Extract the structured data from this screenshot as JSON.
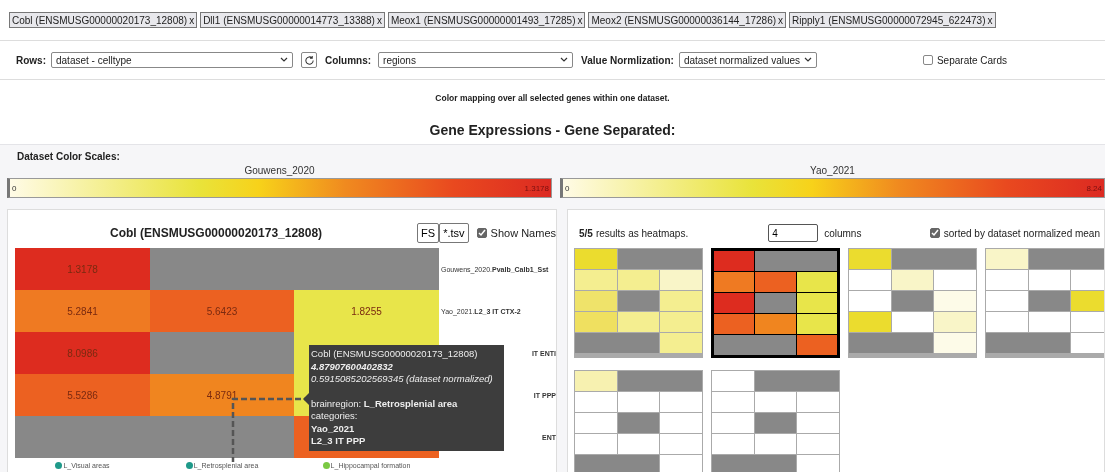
{
  "gene_tags": [
    {
      "label": "Cobl (ENSMUSG00000020173_12808)",
      "remove": "x"
    },
    {
      "label": "Dll1 (ENSMUSG00000014773_13388)",
      "remove": "x"
    },
    {
      "label": "Meox1 (ENSMUSG00000001493_17285)",
      "remove": "x"
    },
    {
      "label": "Meox2 (ENSMUSG00000036144_17286)",
      "remove": "x"
    },
    {
      "label": "Ripply1 (ENSMUSG00000072945_622473)",
      "remove": "x"
    }
  ],
  "controls": {
    "rows": {
      "label": "Rows:",
      "value": "dataset - celltype"
    },
    "columns": {
      "label": "Columns:",
      "value": "regions"
    },
    "normalization": {
      "label": "Value Normlization:",
      "value": "dataset normalized values"
    },
    "separate_cards": {
      "label": "Separate Cards",
      "checked": false
    }
  },
  "note": "Color mapping over all selected genes within one dataset.",
  "heading": "Gene Expressions - Gene Separated:",
  "color_scales": {
    "title": "Dataset Color Scales:",
    "scales": [
      {
        "name": "Gouwens_2020",
        "min": "0",
        "max": "1.3178"
      },
      {
        "name": "Yao_2021",
        "min": "0",
        "max": "8.24"
      }
    ]
  },
  "gene_panel": {
    "title": "Cobl (ENSMUSG00000020173_12808)",
    "buttons": [
      "FS",
      "*.tsv"
    ],
    "show_names": {
      "label": "Show Names",
      "checked": true
    },
    "rows": [
      {
        "prefix": "Gouwens_2020.",
        "name": "Pvalb_Calb1_Sst",
        "cells": [
          {
            "kind": "value",
            "color": "#dd2c1f",
            "value": "1.3178"
          },
          {
            "kind": "empty",
            "color": "#888888"
          },
          {
            "kind": "empty",
            "color": "#888888"
          }
        ]
      },
      {
        "prefix": "Yao_2021.",
        "name": "L2_3 IT CTX-2",
        "cells": [
          {
            "kind": "value",
            "color": "#ef7a22",
            "value": "5.2841"
          },
          {
            "kind": "value",
            "color": "#ec6121",
            "value": "5.6423"
          },
          {
            "kind": "value",
            "color": "#e8e54a",
            "value": "1.8255"
          }
        ]
      },
      {
        "name": "IT ENTl",
        "cells": [
          {
            "kind": "value",
            "color": "#dd2c1f",
            "value": "8.0986"
          },
          {
            "kind": "empty",
            "color": "#888888"
          },
          {
            "kind": "value",
            "color": "#e8e54a"
          }
        ]
      },
      {
        "name": "IT PPP",
        "cells": [
          {
            "kind": "value",
            "color": "#ec6121",
            "value": "5.5286"
          },
          {
            "kind": "value",
            "color": "#f0851f",
            "value": "4.8791"
          },
          {
            "kind": "value",
            "color": "#e8e54a"
          }
        ]
      },
      {
        "name": "ENT",
        "cells": [
          {
            "kind": "empty",
            "color": "#888888"
          },
          {
            "kind": "empty",
            "color": "#888888"
          },
          {
            "kind": "value",
            "color": "#ec6121"
          }
        ]
      }
    ],
    "axis_labels": [
      {
        "label": "L_Visual areas",
        "color": "#1f9a8a"
      },
      {
        "label": "L_Retrosplenial area",
        "color": "#1f9a8a"
      },
      {
        "label": "L_Hippocampal formation",
        "color": "#7ac943"
      }
    ],
    "tooltip": [
      {
        "kind": "plain",
        "text": "Cobl (ENSMUSG00000020173_12808)"
      },
      {
        "kind": "value",
        "text": "4.87907600402832"
      },
      {
        "kind": "normalized",
        "text": "0.5915085202569345 (dataset normalized)"
      },
      {
        "kind": "field",
        "text": "brainregion: **L_Retrosplenial area**"
      },
      {
        "kind": "plain",
        "text": "categories:"
      },
      {
        "kind": "strong",
        "text": "Yao_2021"
      },
      {
        "kind": "strong",
        "text": "L2_3 IT PPP"
      }
    ]
  },
  "results_panel": {
    "count": "5/5",
    "summary": "results as heatmaps.",
    "columns_value": "4",
    "columns_label": "columns",
    "sorted": {
      "label": "sorted by dataset normalized mean",
      "checked": true
    },
    "heatmaps": [
      {
        "selected": false,
        "cells": [
          {
            "kind": "value",
            "color": "#ebdc2e"
          },
          {
            "kind": "empty",
            "color": "#888888"
          },
          {
            "kind": "empty",
            "color": "#888888"
          },
          {
            "kind": "value",
            "color": "#f4ee90"
          },
          {
            "kind": "value",
            "color": "#f4ee90"
          },
          {
            "kind": "value",
            "color": "#f9f5c8"
          },
          {
            "kind": "value",
            "color": "#efe36a"
          },
          {
            "kind": "empty",
            "color": "#888888"
          },
          {
            "kind": "value",
            "color": "#f4ee90"
          },
          {
            "kind": "value",
            "color": "#efe060"
          },
          {
            "kind": "value",
            "color": "#f4ee90"
          },
          {
            "kind": "value",
            "color": "#f4ee90"
          },
          {
            "kind": "empty",
            "color": "#888888"
          },
          {
            "kind": "empty",
            "color": "#888888"
          },
          {
            "kind": "value",
            "color": "#f4ee90"
          }
        ]
      },
      {
        "selected": true,
        "cells": [
          {
            "kind": "value",
            "color": "#dd2c1f"
          },
          {
            "kind": "empty",
            "color": "#888888"
          },
          {
            "kind": "empty",
            "color": "#888888"
          },
          {
            "kind": "value",
            "color": "#ef7a22"
          },
          {
            "kind": "value",
            "color": "#ec6121"
          },
          {
            "kind": "value",
            "color": "#e8e54a"
          },
          {
            "kind": "value",
            "color": "#dd2c1f"
          },
          {
            "kind": "empty",
            "color": "#888888"
          },
          {
            "kind": "value",
            "color": "#e8e54a"
          },
          {
            "kind": "value",
            "color": "#ec6121"
          },
          {
            "kind": "value",
            "color": "#f0851f"
          },
          {
            "kind": "value",
            "color": "#e8e54a"
          },
          {
            "kind": "empty",
            "color": "#888888"
          },
          {
            "kind": "empty",
            "color": "#888888"
          },
          {
            "kind": "value",
            "color": "#ec6121"
          }
        ]
      },
      {
        "selected": false,
        "cells": [
          {
            "kind": "value",
            "color": "#ebdc2e"
          },
          {
            "kind": "empty",
            "color": "#888888"
          },
          {
            "kind": "empty",
            "color": "#888888"
          },
          {
            "kind": "value",
            "color": "#ffffff"
          },
          {
            "kind": "value",
            "color": "#f9f5c8"
          },
          {
            "kind": "value",
            "color": "#ffffff"
          },
          {
            "kind": "value",
            "color": "#ffffff"
          },
          {
            "kind": "empty",
            "color": "#888888"
          },
          {
            "kind": "value",
            "color": "#fdfbe8"
          },
          {
            "kind": "value",
            "color": "#ebdc2e"
          },
          {
            "kind": "value",
            "color": "#ffffff"
          },
          {
            "kind": "value",
            "color": "#f9f5c8"
          },
          {
            "kind": "empty",
            "color": "#888888"
          },
          {
            "kind": "empty",
            "color": "#888888"
          },
          {
            "kind": "value",
            "color": "#fdfbe8"
          }
        ]
      },
      {
        "selected": false,
        "cells": [
          {
            "kind": "value",
            "color": "#f9f5c8"
          },
          {
            "kind": "empty",
            "color": "#888888"
          },
          {
            "kind": "empty",
            "color": "#888888"
          },
          {
            "kind": "value",
            "color": "#ffffff"
          },
          {
            "kind": "value",
            "color": "#ffffff"
          },
          {
            "kind": "value",
            "color": "#ffffff"
          },
          {
            "kind": "value",
            "color": "#ffffff"
          },
          {
            "kind": "empty",
            "color": "#888888"
          },
          {
            "kind": "value",
            "color": "#ebdc2e"
          },
          {
            "kind": "value",
            "color": "#ffffff"
          },
          {
            "kind": "value",
            "color": "#ffffff"
          },
          {
            "kind": "value",
            "color": "#ffffff"
          },
          {
            "kind": "empty",
            "color": "#888888"
          },
          {
            "kind": "empty",
            "color": "#888888"
          },
          {
            "kind": "value",
            "color": "#ffffff"
          }
        ]
      },
      {
        "selected": false,
        "cells": [
          {
            "kind": "value",
            "color": "#f7f1b0"
          },
          {
            "kind": "empty",
            "color": "#888888"
          },
          {
            "kind": "empty",
            "color": "#888888"
          },
          {
            "kind": "value",
            "color": "#ffffff"
          },
          {
            "kind": "value",
            "color": "#ffffff"
          },
          {
            "kind": "value",
            "color": "#ffffff"
          },
          {
            "kind": "value",
            "color": "#ffffff"
          },
          {
            "kind": "empty",
            "color": "#888888"
          },
          {
            "kind": "value",
            "color": "#ffffff"
          },
          {
            "kind": "value",
            "color": "#ffffff"
          },
          {
            "kind": "value",
            "color": "#ffffff"
          },
          {
            "kind": "value",
            "color": "#ffffff"
          },
          {
            "kind": "empty",
            "color": "#888888"
          },
          {
            "kind": "empty",
            "color": "#888888"
          },
          {
            "kind": "value",
            "color": "#ffffff"
          }
        ]
      },
      {
        "selected": false,
        "cells": [
          {
            "kind": "value",
            "color": "#ffffff"
          },
          {
            "kind": "empty",
            "color": "#888888"
          },
          {
            "kind": "empty",
            "color": "#888888"
          },
          {
            "kind": "value",
            "color": "#ffffff"
          },
          {
            "kind": "value",
            "color": "#ffffff"
          },
          {
            "kind": "value",
            "color": "#ffffff"
          },
          {
            "kind": "value",
            "color": "#ffffff"
          },
          {
            "kind": "empty",
            "color": "#888888"
          },
          {
            "kind": "value",
            "color": "#ffffff"
          },
          {
            "kind": "value",
            "color": "#ffffff"
          },
          {
            "kind": "value",
            "color": "#ffffff"
          },
          {
            "kind": "value",
            "color": "#ffffff"
          },
          {
            "kind": "empty",
            "color": "#888888"
          },
          {
            "kind": "empty",
            "color": "#888888"
          },
          {
            "kind": "value",
            "color": "#ffffff"
          }
        ]
      }
    ]
  }
}
